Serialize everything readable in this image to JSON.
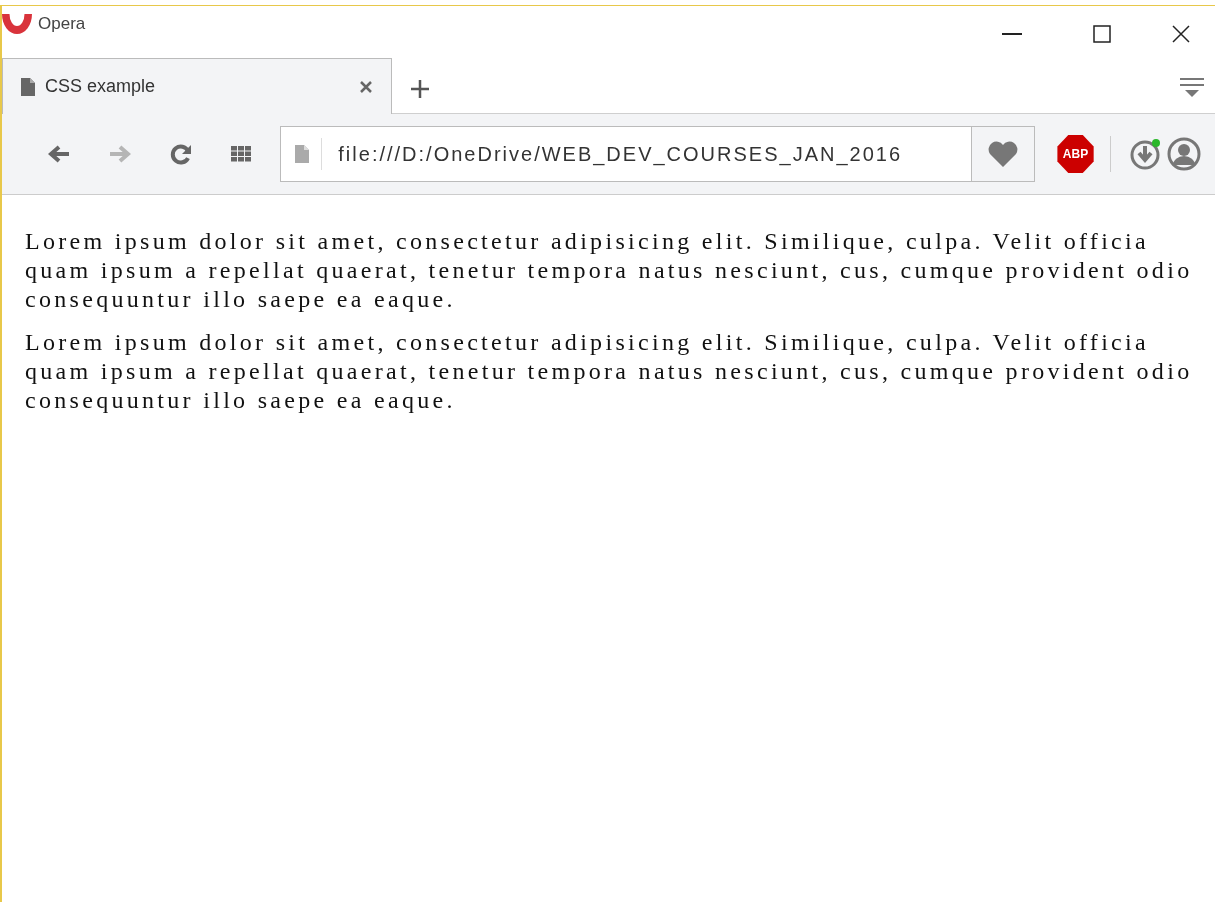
{
  "window": {
    "menu_label": "Opera"
  },
  "tabs": [
    {
      "title": "CSS example",
      "selected": true
    }
  ],
  "nav_buttons": [
    {
      "kind": "back",
      "disabled": false
    },
    {
      "kind": "forward",
      "disabled": true
    },
    {
      "kind": "reload",
      "disabled": false
    },
    {
      "kind": "speed-dial",
      "disabled": false
    }
  ],
  "address_bar": {
    "value": "file:///D:/OneDrive/WEB_DEV_COURSES_JAN_2016"
  },
  "extensions": {
    "adblock_label": "ABP"
  },
  "page": {
    "paragraphs": [
      "Lorem ipsum dolor sit amet, consectetur adipisicing elit. Similique, culpa. Velit officia quam ipsum a repellat quaerat, tenetur tempora natus nesciunt, cus, cumque provident odio consequuntur illo saepe ea eaque.",
      "Lorem ipsum dolor sit amet, consectetur adipisicing elit. Similique, culpa. Velit officia quam ipsum a repellat quaerat, tenetur tempora natus nesciunt, cus, cumque provident odio consequuntur illo saepe ea eaque."
    ]
  }
}
